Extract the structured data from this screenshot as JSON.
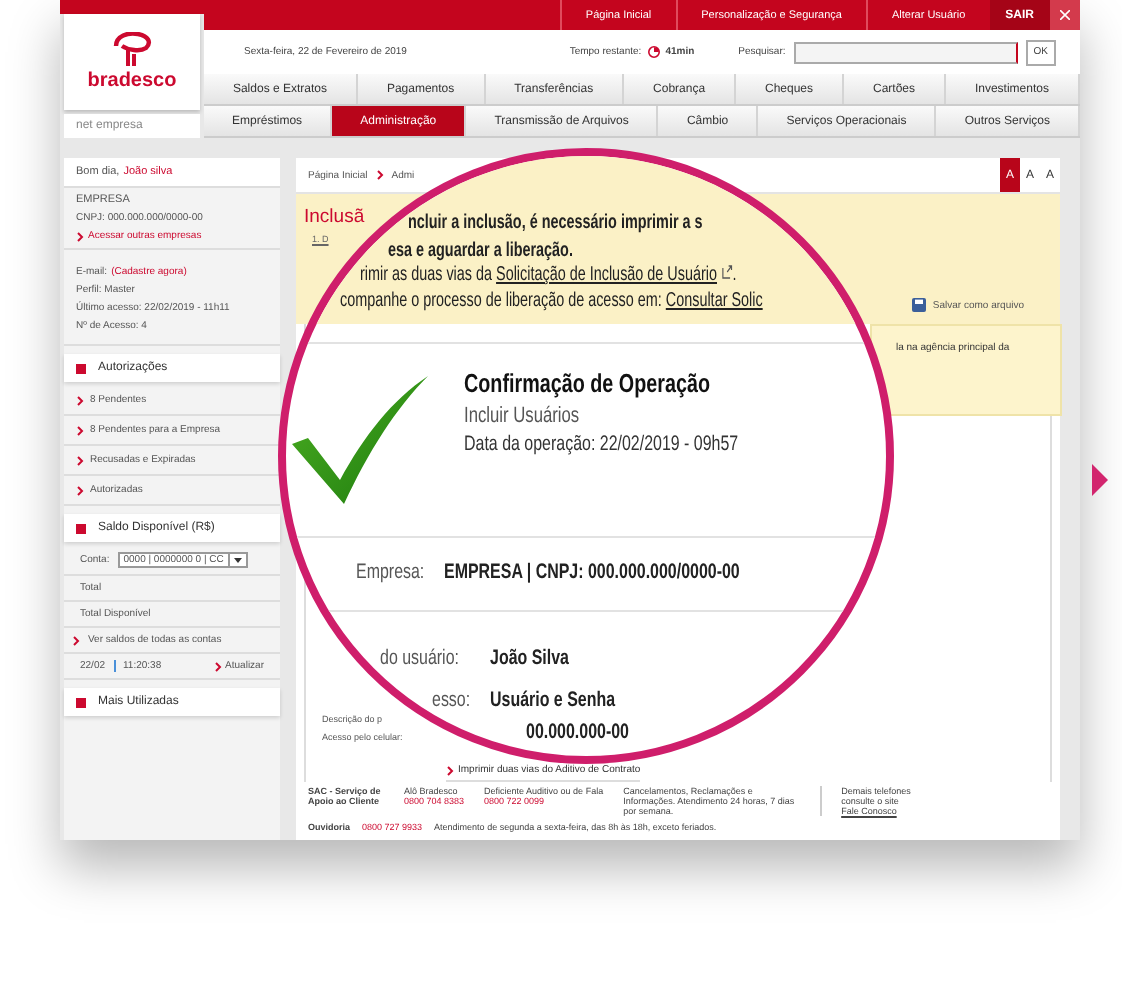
{
  "top_links": [
    {
      "label": "Página Inicial"
    },
    {
      "label": "Personalização e Segurança"
    },
    {
      "label": "Alterar Usuário"
    }
  ],
  "logout": "SAIR",
  "logo": {
    "name": "bradesco",
    "subtitle": "net empresa"
  },
  "info_bar": {
    "date": "Sexta-feira, 22 de Fevereiro de 2019",
    "timer_label": "Tempo restante:",
    "timer_value": "41min",
    "search_label": "Pesquisar:",
    "search_button": "OK"
  },
  "menu_rows": [
    [
      {
        "label": "Saldos e Extratos",
        "selected": false
      },
      {
        "label": "Pagamentos",
        "selected": false
      },
      {
        "label": "Transferências",
        "selected": false
      },
      {
        "label": "Cobrança",
        "selected": false
      },
      {
        "label": "Cheques",
        "selected": false
      },
      {
        "label": "Cartões",
        "selected": false
      },
      {
        "label": "Investimentos",
        "selected": false
      }
    ],
    [
      {
        "label": "Empréstimos",
        "selected": false
      },
      {
        "label": "Administração",
        "selected": true
      },
      {
        "label": "Transmissão de Arquivos",
        "selected": false
      },
      {
        "label": "Câmbio",
        "selected": false
      },
      {
        "label": "Serviços Operacionais",
        "selected": false
      },
      {
        "label": "Outros Serviços",
        "selected": false
      }
    ]
  ],
  "sidebar": {
    "greeting": "Bom dia,",
    "user_name": "João silva",
    "company": "EMPRESA",
    "cnpj": "CNPJ: 000.000.000/0000-00",
    "switch_company": "Acessar outras empresas",
    "email_label": "E-mail:",
    "email_action": "(Cadastre agora)",
    "profile": "Perfil: Master",
    "last_access": "Último acesso: 22/02/2019 - 11h11",
    "access_count": "Nº de Acesso: 4",
    "authorizations": {
      "title": "Autorizações",
      "items": [
        "8 Pendentes",
        "8 Pendentes para a Empresa",
        "Recusadas e Expiradas",
        "Autorizadas"
      ]
    },
    "balance": {
      "title": "Saldo Disponível (R$)",
      "account_label": "Conta:",
      "account_value": "0000 | 0000000 0 | CC",
      "total": "Total",
      "total_available": "Total Disponível",
      "all_accounts_link": "Ver saldos de todas as contas",
      "timestamp_date": "22/02",
      "timestamp_time": "11:20:38",
      "refresh": "Atualizar"
    },
    "most_used": {
      "title": "Mais Utilizadas"
    }
  },
  "main": {
    "breadcrumb": [
      "Página Inicial",
      "Admi"
    ],
    "font_sizes": [
      {
        "label": "A",
        "selected": true
      },
      {
        "label": "A",
        "selected": false
      },
      {
        "label": "A",
        "selected": false
      }
    ],
    "page_title": "Inclusã",
    "step": "1. D",
    "save_button": "Salvar como arquivo",
    "note": "la na agência principal da",
    "description_label": "Descrição do p",
    "mobile_label": "Acesso pelo celular:",
    "contract_link": "Imprimir duas vias do Aditivo de Contrato"
  },
  "lens": {
    "notice_bold": [
      "ncluir a inclusão, é necessário imprimir a s",
      "esa e aguardar a liberação."
    ],
    "print_prefix": "rimir as duas vias da ",
    "print_link": "Solicitação de Inclusão de Usuário",
    "print_suffix": ".",
    "track_prefix": "companhe o processo de liberação de acesso em: ",
    "track_link": "Consultar Solic",
    "title": "Confirmação de Operação",
    "subtitle": "Incluir Usuários",
    "date": "Data da operação: 22/02/2019 - 09h57",
    "fields": [
      {
        "label": "Empresa:",
        "value": "EMPRESA | CNPJ: 000.000.000/0000-00"
      },
      {
        "label": "do usuário:",
        "value": "João Silva"
      },
      {
        "label": "esso:",
        "value": "Usuário e Senha"
      }
    ],
    "phone_fragment": "00.000.000-00"
  },
  "footer": {
    "sac_title": "SAC - Serviço de Apoio ao Cliente",
    "phones": [
      {
        "label": "Alô Bradesco",
        "number": "0800 704 8383"
      },
      {
        "label": "Deficiente Auditivo ou de Fala",
        "number": "0800 722 0099"
      }
    ],
    "hours": "Cancelamentos, Reclamações e Informações. Atendimento 24 horas, 7 dias por semana.",
    "other_phones": "Demais telefones consulte o site",
    "contact_link": "Fale Conosco",
    "ombudsman_label": "Ouvidoria",
    "ombudsman_number": "0800 727 9933",
    "ombudsman_hours": "Atendimento de segunda a sexta-feira, das 8h às 18h, exceto feriados."
  }
}
